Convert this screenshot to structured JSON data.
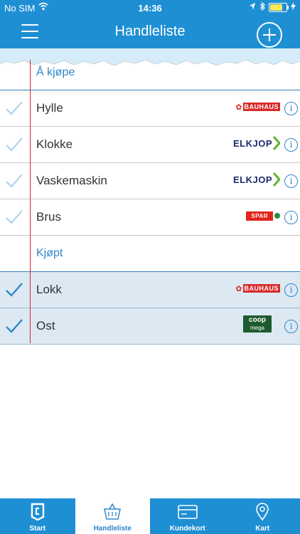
{
  "status": {
    "carrier": "No SIM",
    "time": "14:36"
  },
  "header": {
    "title": "Handleliste"
  },
  "sections": {
    "to_buy": "Å kjøpe",
    "bought": "Kjøpt"
  },
  "items_to_buy": [
    {
      "name": "Hylle",
      "store": "BAUHAUS"
    },
    {
      "name": "Klokke",
      "store": "ELKJOP"
    },
    {
      "name": "Vaskemaskin",
      "store": "ELKJOP"
    },
    {
      "name": "Brus",
      "store": "SPAR"
    }
  ],
  "items_bought": [
    {
      "name": "Lokk",
      "store": "BAUHAUS"
    },
    {
      "name": "Ost",
      "store": "coop mega"
    }
  ],
  "logos": {
    "bauhaus": "BAUHAUS",
    "elkjop": "ELKJOP",
    "spar": "SPAR",
    "coop_top": "coop",
    "coop_bottom": "mega"
  },
  "tabs": [
    "Start",
    "Handleliste",
    "Kundekort",
    "Kart"
  ],
  "colors": {
    "accent": "#1f8fd4",
    "margin_line": "#d0243a",
    "bought_row": "#dce9f3",
    "check_light": "#a9cfee",
    "check_dark": "#2f86c7"
  }
}
